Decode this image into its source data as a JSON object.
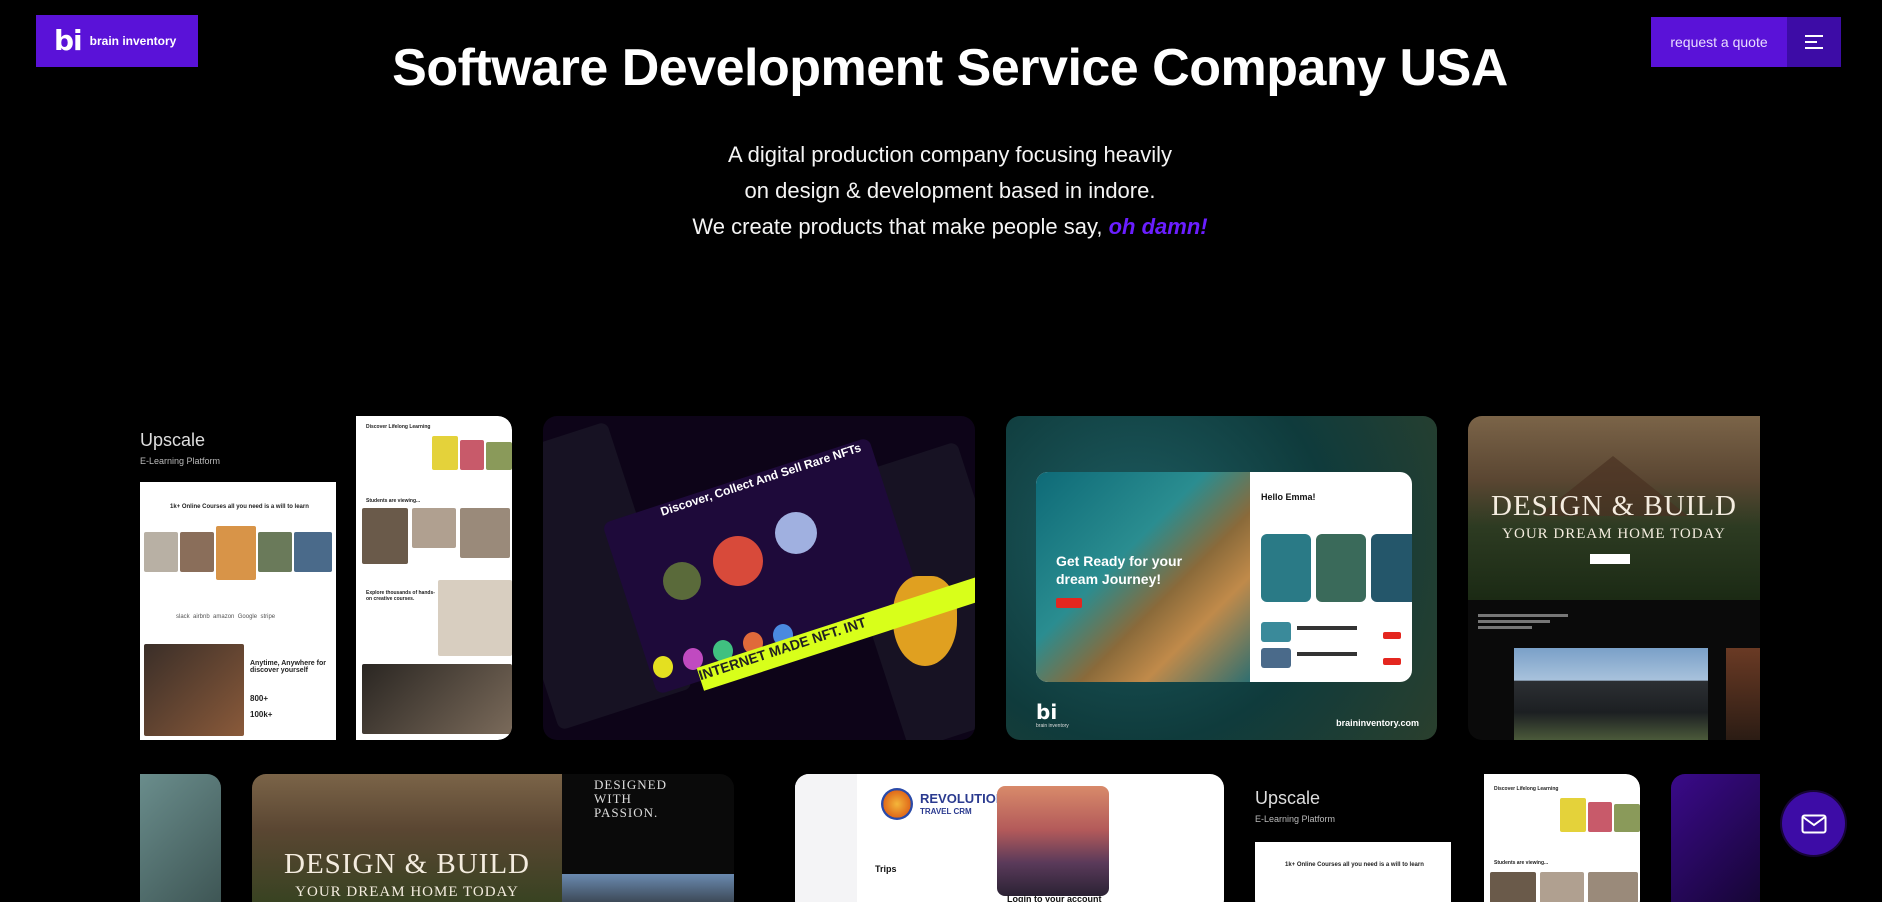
{
  "brand": {
    "logo_mark": "bi",
    "logo_text": "brain inventory"
  },
  "header": {
    "quote_label": "request a quote",
    "menu_icon": "hamburger-icon"
  },
  "hero": {
    "title": "Software Development Service Company USA",
    "line1": "A digital production company focusing heavily",
    "line2": "on design & development based in indore.",
    "line3_prefix": "We create products that make people say, ",
    "line3_accent": "oh damn!"
  },
  "portfolio": {
    "learning": {
      "title": "Upscale",
      "subtitle": "E-Learning Platform",
      "hero_line": "1k+ Online Courses all you need is a will to learn",
      "side_heading": "Discover Lifelong Learning",
      "students": "Students are viewing...",
      "explore": "Explore thousands of hands-on creative courses.",
      "anytime": "Anytime, Anywhere for discover yourself",
      "stat1": "800+",
      "stat2": "100k+",
      "partners": [
        "slack",
        "airbnb",
        "amazon",
        "Google",
        "stripe"
      ]
    },
    "nft": {
      "heading": "Discover, Collect And Sell Rare NFTs",
      "banner": "INTERNET MADE NFT. INT"
    },
    "travel": {
      "headline": "Get Ready for your dream Journey!",
      "greeting": "Hello Emma!",
      "logo_mark": "bi",
      "logo_sub": "brain inventory",
      "url": "braininventory.com"
    },
    "house": {
      "title": "DESIGN & BUILD",
      "subtitle": "YOUR DREAM HOME TODAY"
    },
    "row2": {
      "house_title": "DESIGN & BUILD",
      "house_subtitle": "YOUR DREAM HOME TODAY",
      "passion": "DESIGNED WITH PASSION.",
      "crm_title_line1": "REVOLUTION",
      "crm_title_line2": "TRAVEL CRM",
      "crm_trips": "Trips",
      "crm_login": "Login to your account",
      "learning_title": "Upscale",
      "learning_subtitle": "E-Learning Platform",
      "learning_hero_line": "1k+ Online Courses all you need is a will to learn",
      "learning_side_heading": "Discover Lifelong Learning",
      "learning_students": "Students are viewing..."
    }
  },
  "contact": {
    "icon": "mail-icon"
  },
  "colors": {
    "brand": "#5a12d8",
    "brand_dark": "#3d0ca6",
    "accent_text": "#6a1eff",
    "background": "#000000"
  }
}
